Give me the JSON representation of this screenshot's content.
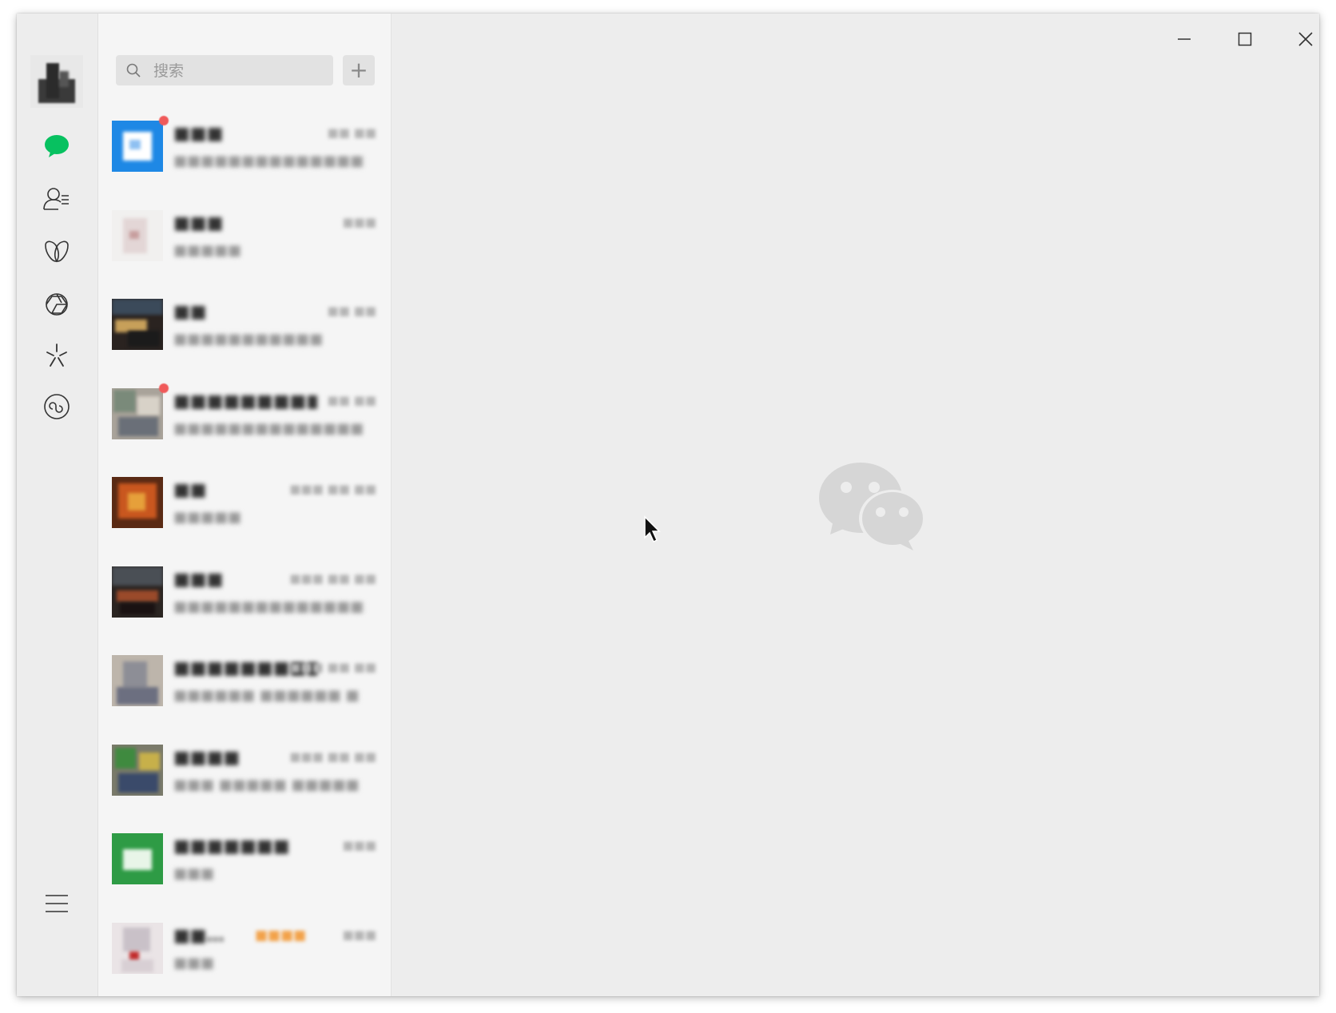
{
  "app": {
    "name": "WeChat"
  },
  "window_controls": {
    "minimize_icon": "minimize-icon",
    "maximize_icon": "maximize-icon",
    "close_icon": "close-icon"
  },
  "nav": {
    "items": [
      {
        "name": "chats",
        "icon": "chat-bubble-icon",
        "active": true
      },
      {
        "name": "contacts",
        "icon": "contacts-icon",
        "active": false
      },
      {
        "name": "favorites",
        "icon": "favorites-icon",
        "active": false
      },
      {
        "name": "moments",
        "icon": "moments-icon",
        "active": false
      },
      {
        "name": "channels",
        "icon": "channels-icon",
        "active": false
      },
      {
        "name": "mini-programs",
        "icon": "mini-programs-icon",
        "active": false
      }
    ],
    "menu_icon": "menu-icon"
  },
  "search": {
    "placeholder": "搜索",
    "value": ""
  },
  "add_button": {
    "label": "+"
  },
  "colors": {
    "accent": "#07c160",
    "unread_badge": "#f05a5a",
    "panel_bg": "#f5f5f5",
    "main_bg": "#ededed"
  }
}
